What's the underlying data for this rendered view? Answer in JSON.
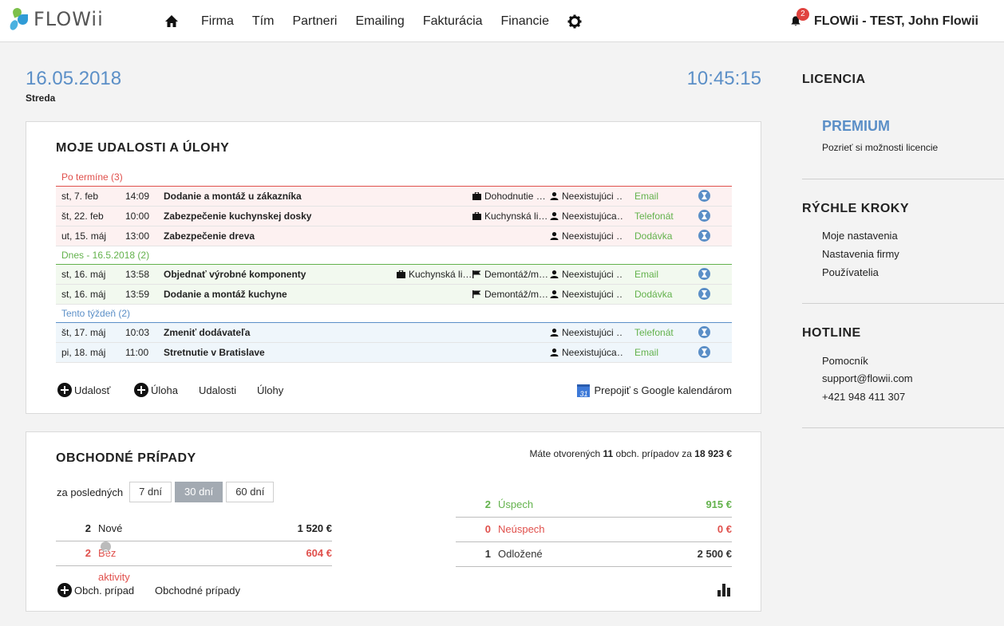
{
  "app": {
    "brand": "FLOWii"
  },
  "nav": {
    "items": [
      "Firma",
      "Tím",
      "Partneri",
      "Emailing",
      "Fakturácia",
      "Financie"
    ]
  },
  "user": {
    "notifications": "2",
    "name": "FLOWii - TEST, John Flowii"
  },
  "header": {
    "date": "16.05.2018",
    "weekday": "Streda",
    "time": "10:45:15"
  },
  "events": {
    "title": "MOJE UDALOSTI A ÚLOHY",
    "groups": [
      {
        "label": "Po termíne (3)",
        "rows": [
          {
            "date": "st, 7. feb",
            "time": "14:09",
            "title": "Dodanie a montáž u zákazníka",
            "case": "Dohodnutie …",
            "task": "",
            "person": "Neexistujúci …",
            "type": "Email"
          },
          {
            "date": "št, 22. feb",
            "time": "10:00",
            "title": "Zabezpečenie kuchynskej dosky",
            "case": "Kuchynská li…",
            "task": "",
            "person": "Neexistujúca…",
            "type": "Telefonát"
          },
          {
            "date": "ut, 15. máj",
            "time": "13:00",
            "title": "Zabezpečenie dreva",
            "case": "",
            "task": "",
            "person": "Neexistujúci …",
            "type": "Dodávka"
          }
        ]
      },
      {
        "label": "Dnes - 16.5.2018 (2)",
        "rows": [
          {
            "date": "st, 16. máj",
            "time": "13:58",
            "title": "Objednať výrobné komponenty",
            "case": "Kuchynská li…",
            "task": "Demontáž/m…",
            "person": "Neexistujúci …",
            "type": "Email"
          },
          {
            "date": "st, 16. máj",
            "time": "13:59",
            "title": "Dodanie a montáž kuchyne",
            "case": "",
            "task": "Demontáž/m…",
            "person": "Neexistujúci …",
            "type": "Dodávka"
          }
        ]
      },
      {
        "label": "Tento týždeň (2)",
        "rows": [
          {
            "date": "št, 17. máj",
            "time": "10:03",
            "title": "Zmeniť dodávateľa",
            "case": "",
            "task": "",
            "person": "Neexistujúci …",
            "type": "Telefonát"
          },
          {
            "date": "pi, 18. máj",
            "time": "11:00",
            "title": "Stretnutie v Bratislave",
            "case": "",
            "task": "",
            "person": "Neexistujúca…",
            "type": "Email"
          }
        ]
      }
    ],
    "footer": {
      "add_event": "Udalosť",
      "add_task": "Úloha",
      "events_link": "Udalosti",
      "tasks_link": "Úlohy",
      "gcal_icon": "31",
      "google_link": "Prepojiť s Google kalendárom"
    }
  },
  "deals": {
    "title": "OBCHODNÉ PRÍPADY",
    "summary": {
      "prefix": "Máte otvorených ",
      "count": "11",
      "middle": " obch. prípadov za ",
      "amount": "18 923 €"
    },
    "period_label": "za posledných",
    "periods": [
      "7 dní",
      "30 dní",
      "60 dní"
    ],
    "active_period": "30 dní",
    "left": [
      {
        "count": "2",
        "label": "Nové",
        "amount": "1 520 €",
        "color": "#222222"
      },
      {
        "count": "2",
        "label": "Bez aktivity",
        "amount": "604 €",
        "color": "#e0504c"
      }
    ],
    "right": [
      {
        "count": "2",
        "label": "Úspech",
        "amount": "915 €",
        "color": "#63b24c"
      },
      {
        "count": "0",
        "label": "Neúspech",
        "amount": "0 €",
        "color": "#e0504c"
      },
      {
        "count": "1",
        "label": "Odložené",
        "amount": "2 500 €",
        "color": "#333333"
      }
    ],
    "footer": {
      "add_deal": "Obch. prípad",
      "deals_link": "Obchodné prípady"
    }
  },
  "sidebar": {
    "license": {
      "title": "LICENCIA",
      "plan": "PREMIUM",
      "link": "Pozrieť si možnosti licencie"
    },
    "quick": {
      "title": "RÝCHLE KROKY",
      "links": [
        "Moje nastavenia",
        "Nastavenia firmy",
        "Používatelia"
      ]
    },
    "hotline": {
      "title": "HOTLINE",
      "lines": [
        "Pomocník",
        "support@flowii.com",
        "+421 948 411 307"
      ]
    }
  },
  "colors": {
    "accent": "#5b8fc7",
    "overdue": "#e0504c",
    "today": "#63b24c"
  }
}
